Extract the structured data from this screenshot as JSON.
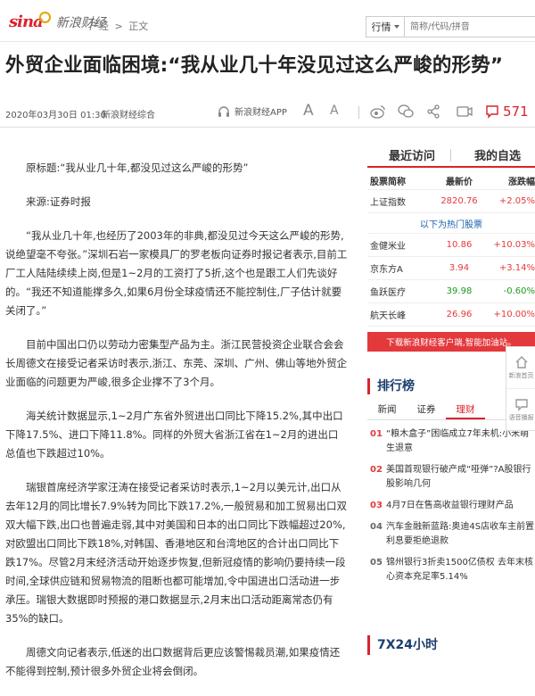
{
  "header": {
    "logo_text": "sina",
    "logo_sub": "新浪财经",
    "breadcrumb": [
      "产经",
      ">",
      "正文"
    ],
    "search_select": "行情",
    "search_placeholder": "简称/代码/拼音"
  },
  "article": {
    "title": "外贸企业面临困境:“我从业几十年没见过这么严峻的形势”",
    "date": "2020年03月30日 01:30",
    "source": "新浪财经综合",
    "app_label": "新浪财经APP",
    "comment_count": "571",
    "paragraphs": [
      "原标题:“我从业几十年,都没见过这么严峻的形势”",
      "来源:证券时报",
      "“我从业几十年,也经历了2003年的非典,都没见过今天这么严峻的形势,说绝望毫不夸张。”深圳石岩一家模具厂的罗老板向证券时报记者表示,目前工厂工人陆陆续续上岗,但是1~2月的工资打了5折,这个也是跟工人们先谈好的。“我还不知道能撑多久,如果6月份全球疫情还不能控制住,厂子估计就要关闭了。”",
      "目前中国出口仍以劳动力密集型产品为主。浙江民营投资企业联合会会长周德文在接受记者采访时表示,浙江、东莞、深圳、广州、佛山等地外贸企业面临的问题更为严峻,很多企业撑不了3个月。",
      "海关统计数据显示,1~2月广东省外贸进出口同比下降15.2%,其中出口下降17.5%、进口下降11.8%。同样的外贸大省浙江省在1~2月的进出口总值也下跌超过10%。",
      "瑞银首席经济学家汪涛在接受记者采访时表示,1~2月以美元计,出口从去年12月的同比增长7.9%转为同比下跌17.2%,一般贸易和加工贸易出口双双大幅下跌,出口也普遍走弱,其中对美国和日本的出口同比下跌幅超过20%,对欧盟出口同比下跌18%,对韩国、香港地区和台湾地区的合计出口同比下跌17%。尽管2月末经济活动开始逐步恢复,但新冠疫情的影响仍要持续一段时间,全球供应链和贸易物流的阻断也都可能增加,令中国进出口活动进一步承压。瑞银大数据即时预报的港口数据显示,2月末出口活动距离常态仍有35%的缺口。",
      "周德文向记者表示,低迷的出口数据背后更应该警惕裁员潮,如果疫情还不能得到控制,预计很多外贸企业将会倒闭。"
    ]
  },
  "sidebar": {
    "tab_recent": "最近访问",
    "tab_mine": "我的自选",
    "col_name": "股票简称",
    "col_price": "最新价",
    "col_change": "涨跌幅",
    "index_row": {
      "name": "上证指数",
      "price": "2820.76",
      "change": "+2.05%"
    },
    "hot_label": "以下为热门股票",
    "stocks": [
      {
        "name": "金健米业",
        "price": "10.86",
        "change": "+10.03%",
        "color": "#e4393c"
      },
      {
        "name": "京东方A",
        "price": "3.94",
        "change": "+3.14%",
        "color": "#e4393c"
      },
      {
        "name": "鱼跃医疗",
        "price": "39.98",
        "change": "-0.60%",
        "color": "#1a9b1a"
      },
      {
        "name": "航天长峰",
        "price": "26.96",
        "change": "+10.00%",
        "color": "#e4393c"
      }
    ],
    "banner": "下载新浪财经客户端,智能加油站。",
    "rank_title": "排行榜",
    "rank_tabs": [
      "新闻",
      "证券",
      "理财"
    ],
    "rank_items": [
      {
        "n": "01",
        "text": "“粮木盒子”困临成立7年未机:小米萌生退意"
      },
      {
        "n": "02",
        "text": "美国首现银行破产成“哑弹”?A股银行股影响几何"
      },
      {
        "n": "03",
        "text": "4月7日在售高收益银行理财产品"
      },
      {
        "n": "04",
        "text": "汽车金融新蓝路:奥迪4S店收车主前置利息要拒绝退款"
      },
      {
        "n": "05",
        "text": "锦州银行3折卖1500亿债权 去年末核心资本充足率5.14%"
      }
    ],
    "x24_title": "7X24小时"
  },
  "tools": [
    {
      "icon": "home-icon",
      "label": "新浪首页"
    },
    {
      "icon": "feedback-icon",
      "label": "语音播报"
    }
  ]
}
